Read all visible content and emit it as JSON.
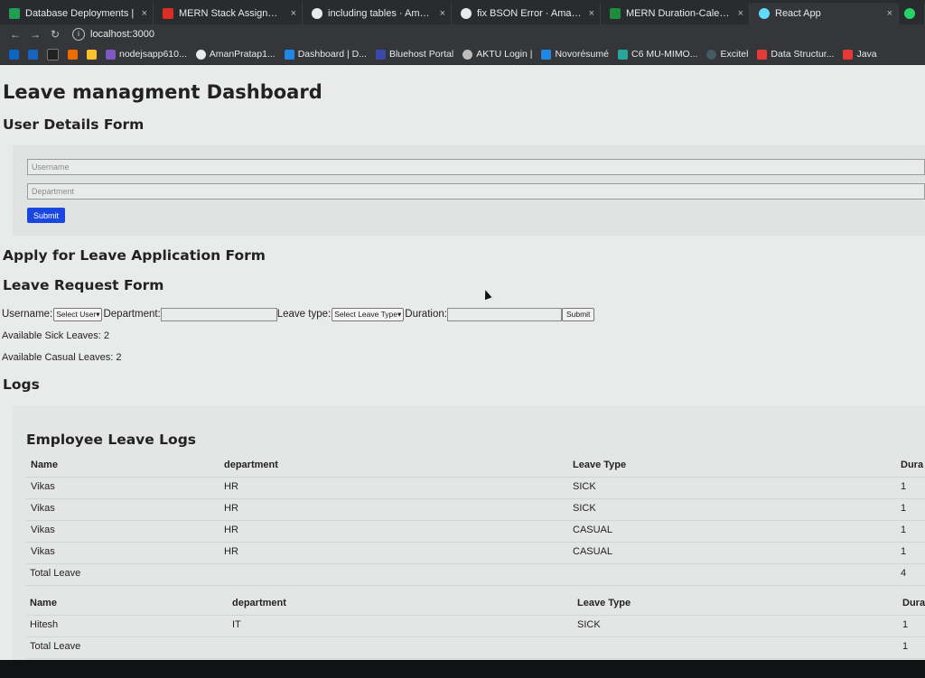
{
  "browser": {
    "tabs": [
      {
        "title": "Database Deployments | ",
        "color": "#1f9d55"
      },
      {
        "title": "MERN Stack Assignment",
        "color": "#d93025"
      },
      {
        "title": "including tables · AmanPr",
        "color": "#e8eaed"
      },
      {
        "title": "fix BSON Error · AmanPra",
        "color": "#e8eaed"
      },
      {
        "title": "MERN Duration-Calendar",
        "color": "#1e8e3e"
      },
      {
        "title": "React App",
        "color": "#61dafb"
      }
    ],
    "close_glyph": "×",
    "url": "localhost:3000",
    "bookmarks": [
      {
        "label": "nodejsapp610...",
        "color": "#7e57c2"
      },
      {
        "label": "AmanPratap1...",
        "color": "#e8eaed"
      },
      {
        "label": "Dashboard | D...",
        "color": "#1e88e5"
      },
      {
        "label": "Bluehost Portal",
        "color": "#3949ab"
      },
      {
        "label": "AKTU Login |",
        "color": "#bdbdbd"
      },
      {
        "label": "Novorésumé",
        "color": "#1e88e5"
      },
      {
        "label": "C6 MU-MIMO...",
        "color": "#26a69a"
      },
      {
        "label": "Excitel",
        "color": "#455a64"
      },
      {
        "label": "Data Structur...",
        "color": "#e53935"
      },
      {
        "label": "Java",
        "color": "#e53935"
      }
    ]
  },
  "page": {
    "title": "Leave managment Dashboard",
    "user_form": {
      "heading": "User Details Form",
      "username_placeholder": "Username",
      "department_placeholder": "Department",
      "submit_label": "Submit"
    },
    "apply_heading": "Apply for Leave Application Form",
    "leave_form": {
      "heading": "Leave Request Form",
      "username_label": "Username:",
      "username_select": "Select User",
      "department_label": "Department:",
      "leave_type_label": "Leave type:",
      "leave_type_select": "Select Leave Type",
      "duration_label": "Duration:",
      "submit_label": "Submit"
    },
    "available_sick": "Available Sick Leaves: 2",
    "available_casual": "Available Casual Leaves: 2",
    "logs_heading": "Logs",
    "employee_logs": {
      "heading": "Employee Leave Logs",
      "headers": [
        "Name",
        "department",
        "Leave Type",
        "Dura"
      ],
      "tables": [
        {
          "rows": [
            [
              "Vikas",
              "HR",
              "SICK",
              "1"
            ],
            [
              "Vikas",
              "HR",
              "SICK",
              "1"
            ],
            [
              "Vikas",
              "HR",
              "CASUAL",
              "1"
            ],
            [
              "Vikas",
              "HR",
              "CASUAL",
              "1"
            ]
          ],
          "total_label": "Total Leave",
          "total_value": "4"
        },
        {
          "rows": [
            [
              "Hitesh",
              "IT",
              "SICK",
              "1"
            ]
          ],
          "total_label": "Total Leave",
          "total_value": "1"
        }
      ]
    }
  }
}
